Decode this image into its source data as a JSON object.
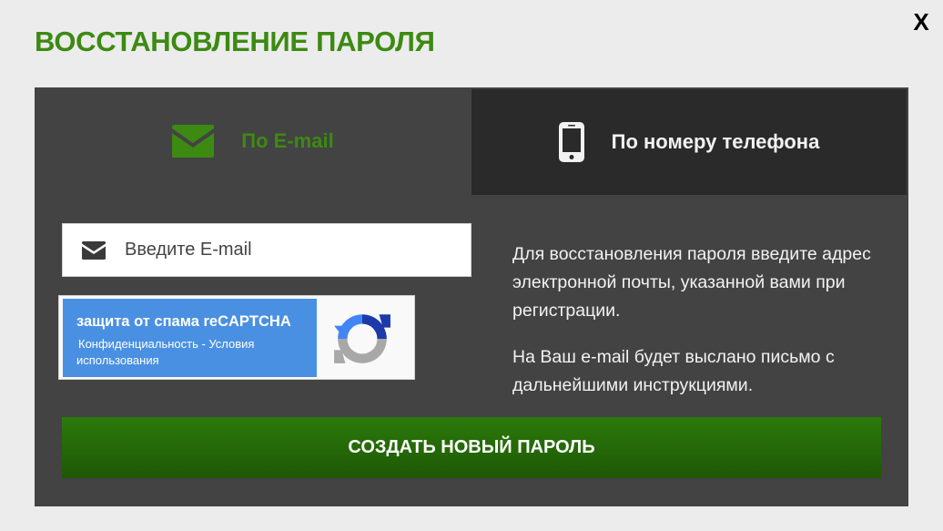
{
  "modal": {
    "title": "ВОССТАНОВЛЕНИЕ ПАРОЛЯ",
    "close_label": "X"
  },
  "tabs": [
    {
      "label": "По E-mail",
      "icon": "envelope-icon",
      "active": true
    },
    {
      "label": "По номеру телефона",
      "icon": "mobile-phone-icon",
      "active": false
    }
  ],
  "email_form": {
    "icon": "envelope-icon",
    "placeholder": "Введите E-mail",
    "value": ""
  },
  "recaptcha": {
    "title": "защита от спама reCAPTCHA",
    "links_line1": "Конфиденциальность - Условия",
    "links_line2": "использования",
    "icon": "recaptcha-logo-icon"
  },
  "info": {
    "paragraph1": "Для восстановления пароля введите адрес электронной почты, указанной вами при регистрации.",
    "paragraph2": "На Ваш e-mail будет выслано письмо с дальнейшими инструкциями."
  },
  "submit": {
    "label": "СОЗДАТЬ НОВЫЙ ПАРОЛЬ"
  },
  "colors": {
    "accent_green": "#3c8a12",
    "panel_bg": "#434343",
    "inactive_tab_bg": "#2a2a2a",
    "button_green": "#2c7a0c",
    "recaptcha_blue": "#4a90e2"
  }
}
